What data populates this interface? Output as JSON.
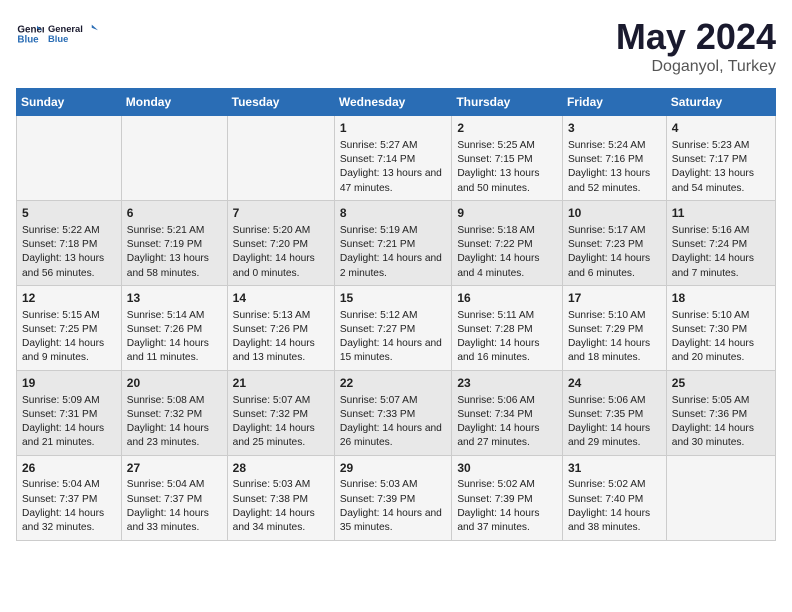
{
  "logo": {
    "line1": "General",
    "line2": "Blue"
  },
  "title": "May 2024",
  "subtitle": "Doganyol, Turkey",
  "days_header": [
    "Sunday",
    "Monday",
    "Tuesday",
    "Wednesday",
    "Thursday",
    "Friday",
    "Saturday"
  ],
  "weeks": [
    [
      {
        "day": "",
        "sunrise": "",
        "sunset": "",
        "daylight": ""
      },
      {
        "day": "",
        "sunrise": "",
        "sunset": "",
        "daylight": ""
      },
      {
        "day": "",
        "sunrise": "",
        "sunset": "",
        "daylight": ""
      },
      {
        "day": "1",
        "sunrise": "Sunrise: 5:27 AM",
        "sunset": "Sunset: 7:14 PM",
        "daylight": "Daylight: 13 hours and 47 minutes."
      },
      {
        "day": "2",
        "sunrise": "Sunrise: 5:25 AM",
        "sunset": "Sunset: 7:15 PM",
        "daylight": "Daylight: 13 hours and 50 minutes."
      },
      {
        "day": "3",
        "sunrise": "Sunrise: 5:24 AM",
        "sunset": "Sunset: 7:16 PM",
        "daylight": "Daylight: 13 hours and 52 minutes."
      },
      {
        "day": "4",
        "sunrise": "Sunrise: 5:23 AM",
        "sunset": "Sunset: 7:17 PM",
        "daylight": "Daylight: 13 hours and 54 minutes."
      }
    ],
    [
      {
        "day": "5",
        "sunrise": "Sunrise: 5:22 AM",
        "sunset": "Sunset: 7:18 PM",
        "daylight": "Daylight: 13 hours and 56 minutes."
      },
      {
        "day": "6",
        "sunrise": "Sunrise: 5:21 AM",
        "sunset": "Sunset: 7:19 PM",
        "daylight": "Daylight: 13 hours and 58 minutes."
      },
      {
        "day": "7",
        "sunrise": "Sunrise: 5:20 AM",
        "sunset": "Sunset: 7:20 PM",
        "daylight": "Daylight: 14 hours and 0 minutes."
      },
      {
        "day": "8",
        "sunrise": "Sunrise: 5:19 AM",
        "sunset": "Sunset: 7:21 PM",
        "daylight": "Daylight: 14 hours and 2 minutes."
      },
      {
        "day": "9",
        "sunrise": "Sunrise: 5:18 AM",
        "sunset": "Sunset: 7:22 PM",
        "daylight": "Daylight: 14 hours and 4 minutes."
      },
      {
        "day": "10",
        "sunrise": "Sunrise: 5:17 AM",
        "sunset": "Sunset: 7:23 PM",
        "daylight": "Daylight: 14 hours and 6 minutes."
      },
      {
        "day": "11",
        "sunrise": "Sunrise: 5:16 AM",
        "sunset": "Sunset: 7:24 PM",
        "daylight": "Daylight: 14 hours and 7 minutes."
      }
    ],
    [
      {
        "day": "12",
        "sunrise": "Sunrise: 5:15 AM",
        "sunset": "Sunset: 7:25 PM",
        "daylight": "Daylight: 14 hours and 9 minutes."
      },
      {
        "day": "13",
        "sunrise": "Sunrise: 5:14 AM",
        "sunset": "Sunset: 7:26 PM",
        "daylight": "Daylight: 14 hours and 11 minutes."
      },
      {
        "day": "14",
        "sunrise": "Sunrise: 5:13 AM",
        "sunset": "Sunset: 7:26 PM",
        "daylight": "Daylight: 14 hours and 13 minutes."
      },
      {
        "day": "15",
        "sunrise": "Sunrise: 5:12 AM",
        "sunset": "Sunset: 7:27 PM",
        "daylight": "Daylight: 14 hours and 15 minutes."
      },
      {
        "day": "16",
        "sunrise": "Sunrise: 5:11 AM",
        "sunset": "Sunset: 7:28 PM",
        "daylight": "Daylight: 14 hours and 16 minutes."
      },
      {
        "day": "17",
        "sunrise": "Sunrise: 5:10 AM",
        "sunset": "Sunset: 7:29 PM",
        "daylight": "Daylight: 14 hours and 18 minutes."
      },
      {
        "day": "18",
        "sunrise": "Sunrise: 5:10 AM",
        "sunset": "Sunset: 7:30 PM",
        "daylight": "Daylight: 14 hours and 20 minutes."
      }
    ],
    [
      {
        "day": "19",
        "sunrise": "Sunrise: 5:09 AM",
        "sunset": "Sunset: 7:31 PM",
        "daylight": "Daylight: 14 hours and 21 minutes."
      },
      {
        "day": "20",
        "sunrise": "Sunrise: 5:08 AM",
        "sunset": "Sunset: 7:32 PM",
        "daylight": "Daylight: 14 hours and 23 minutes."
      },
      {
        "day": "21",
        "sunrise": "Sunrise: 5:07 AM",
        "sunset": "Sunset: 7:32 PM",
        "daylight": "Daylight: 14 hours and 25 minutes."
      },
      {
        "day": "22",
        "sunrise": "Sunrise: 5:07 AM",
        "sunset": "Sunset: 7:33 PM",
        "daylight": "Daylight: 14 hours and 26 minutes."
      },
      {
        "day": "23",
        "sunrise": "Sunrise: 5:06 AM",
        "sunset": "Sunset: 7:34 PM",
        "daylight": "Daylight: 14 hours and 27 minutes."
      },
      {
        "day": "24",
        "sunrise": "Sunrise: 5:06 AM",
        "sunset": "Sunset: 7:35 PM",
        "daylight": "Daylight: 14 hours and 29 minutes."
      },
      {
        "day": "25",
        "sunrise": "Sunrise: 5:05 AM",
        "sunset": "Sunset: 7:36 PM",
        "daylight": "Daylight: 14 hours and 30 minutes."
      }
    ],
    [
      {
        "day": "26",
        "sunrise": "Sunrise: 5:04 AM",
        "sunset": "Sunset: 7:37 PM",
        "daylight": "Daylight: 14 hours and 32 minutes."
      },
      {
        "day": "27",
        "sunrise": "Sunrise: 5:04 AM",
        "sunset": "Sunset: 7:37 PM",
        "daylight": "Daylight: 14 hours and 33 minutes."
      },
      {
        "day": "28",
        "sunrise": "Sunrise: 5:03 AM",
        "sunset": "Sunset: 7:38 PM",
        "daylight": "Daylight: 14 hours and 34 minutes."
      },
      {
        "day": "29",
        "sunrise": "Sunrise: 5:03 AM",
        "sunset": "Sunset: 7:39 PM",
        "daylight": "Daylight: 14 hours and 35 minutes."
      },
      {
        "day": "30",
        "sunrise": "Sunrise: 5:02 AM",
        "sunset": "Sunset: 7:39 PM",
        "daylight": "Daylight: 14 hours and 37 minutes."
      },
      {
        "day": "31",
        "sunrise": "Sunrise: 5:02 AM",
        "sunset": "Sunset: 7:40 PM",
        "daylight": "Daylight: 14 hours and 38 minutes."
      },
      {
        "day": "",
        "sunrise": "",
        "sunset": "",
        "daylight": ""
      }
    ]
  ]
}
